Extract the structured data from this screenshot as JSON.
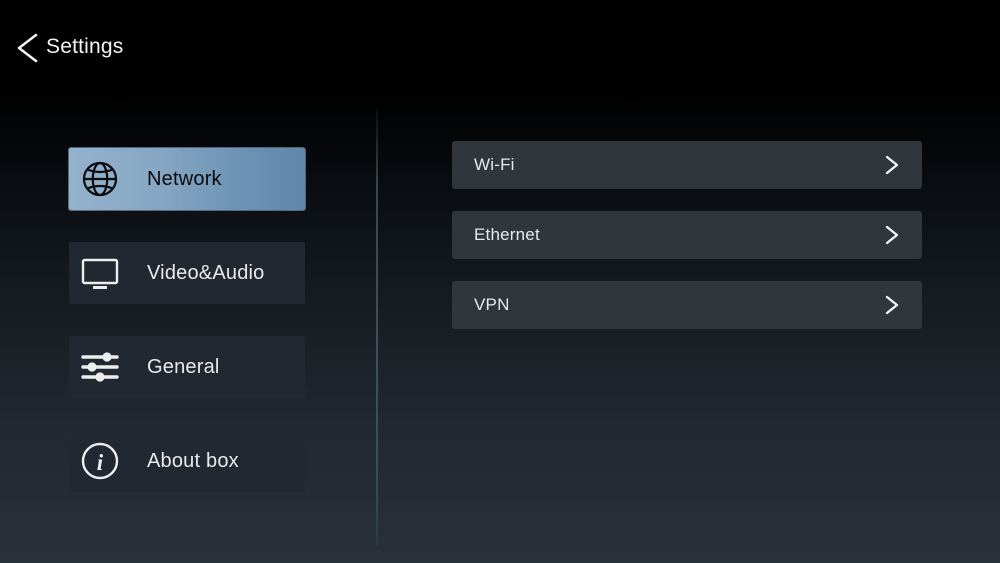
{
  "header": {
    "title": "Settings",
    "back_icon": "chevron-left-icon"
  },
  "sidebar": {
    "items": [
      {
        "label": "Network",
        "icon": "globe-icon",
        "selected": true
      },
      {
        "label": "Video&Audio",
        "icon": "monitor-icon",
        "selected": false
      },
      {
        "label": "General",
        "icon": "sliders-icon",
        "selected": false
      },
      {
        "label": "About box",
        "icon": "info-icon",
        "selected": false
      }
    ]
  },
  "detail": {
    "rows": [
      {
        "label": "Wi-Fi",
        "chevron": "chevron-right-icon"
      },
      {
        "label": "Ethernet",
        "chevron": "chevron-right-icon"
      },
      {
        "label": "VPN",
        "chevron": "chevron-right-icon"
      }
    ]
  },
  "colors": {
    "background_top": "#000000",
    "background_bottom": "#28303a",
    "selected_item_light": "#94b2cd",
    "selected_item_dark": "#5f87ab",
    "nav_item_background": "#222832",
    "row_background": "#31363d",
    "text_primary": "#e9eaec",
    "text_on_selected": "#0a0a0c",
    "divider": "#3c5864"
  }
}
